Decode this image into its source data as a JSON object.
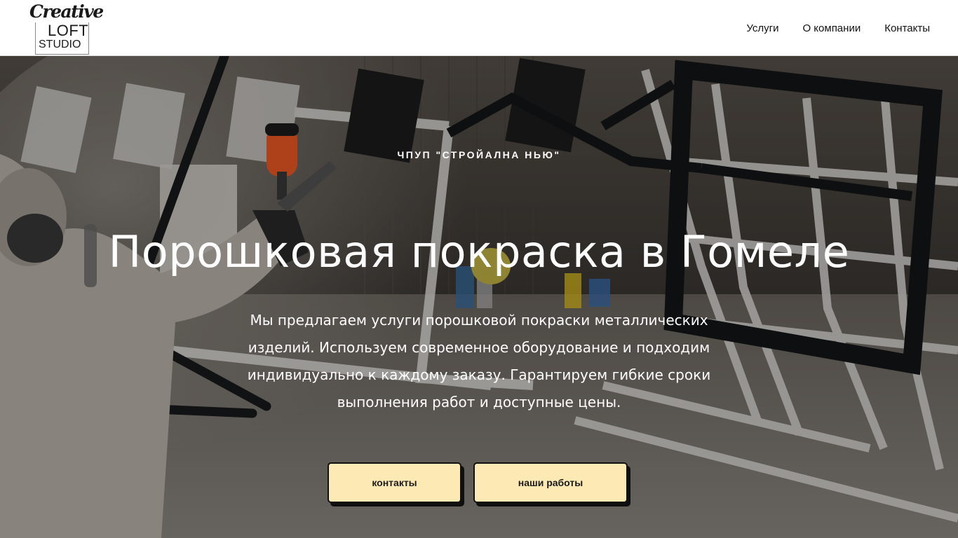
{
  "header": {
    "logo": {
      "line1": "Creative",
      "line2": "LOFT",
      "line3": "STUDIO"
    },
    "nav": [
      {
        "label": "Услуги"
      },
      {
        "label": "О компании"
      },
      {
        "label": "Контакты"
      }
    ]
  },
  "hero": {
    "subtitle": "ЧПУП \"СТРОЙАЛНА НЬЮ\"",
    "title": "Порошковая покраска в Гомеле",
    "description": "Мы предлагаем услуги порошковой покраски металлических изделий. Используем современное оборудование и подходим индивидуально к каждому заказу. Гарантируем гибкие сроки выполнения работ и доступные цены.",
    "buttons": {
      "contacts": "контакты",
      "works": "наши работы"
    }
  },
  "colors": {
    "button_bg": "#fde9b3",
    "button_border": "#111111",
    "header_bg": "#ffffff",
    "hero_text": "#ffffff"
  }
}
